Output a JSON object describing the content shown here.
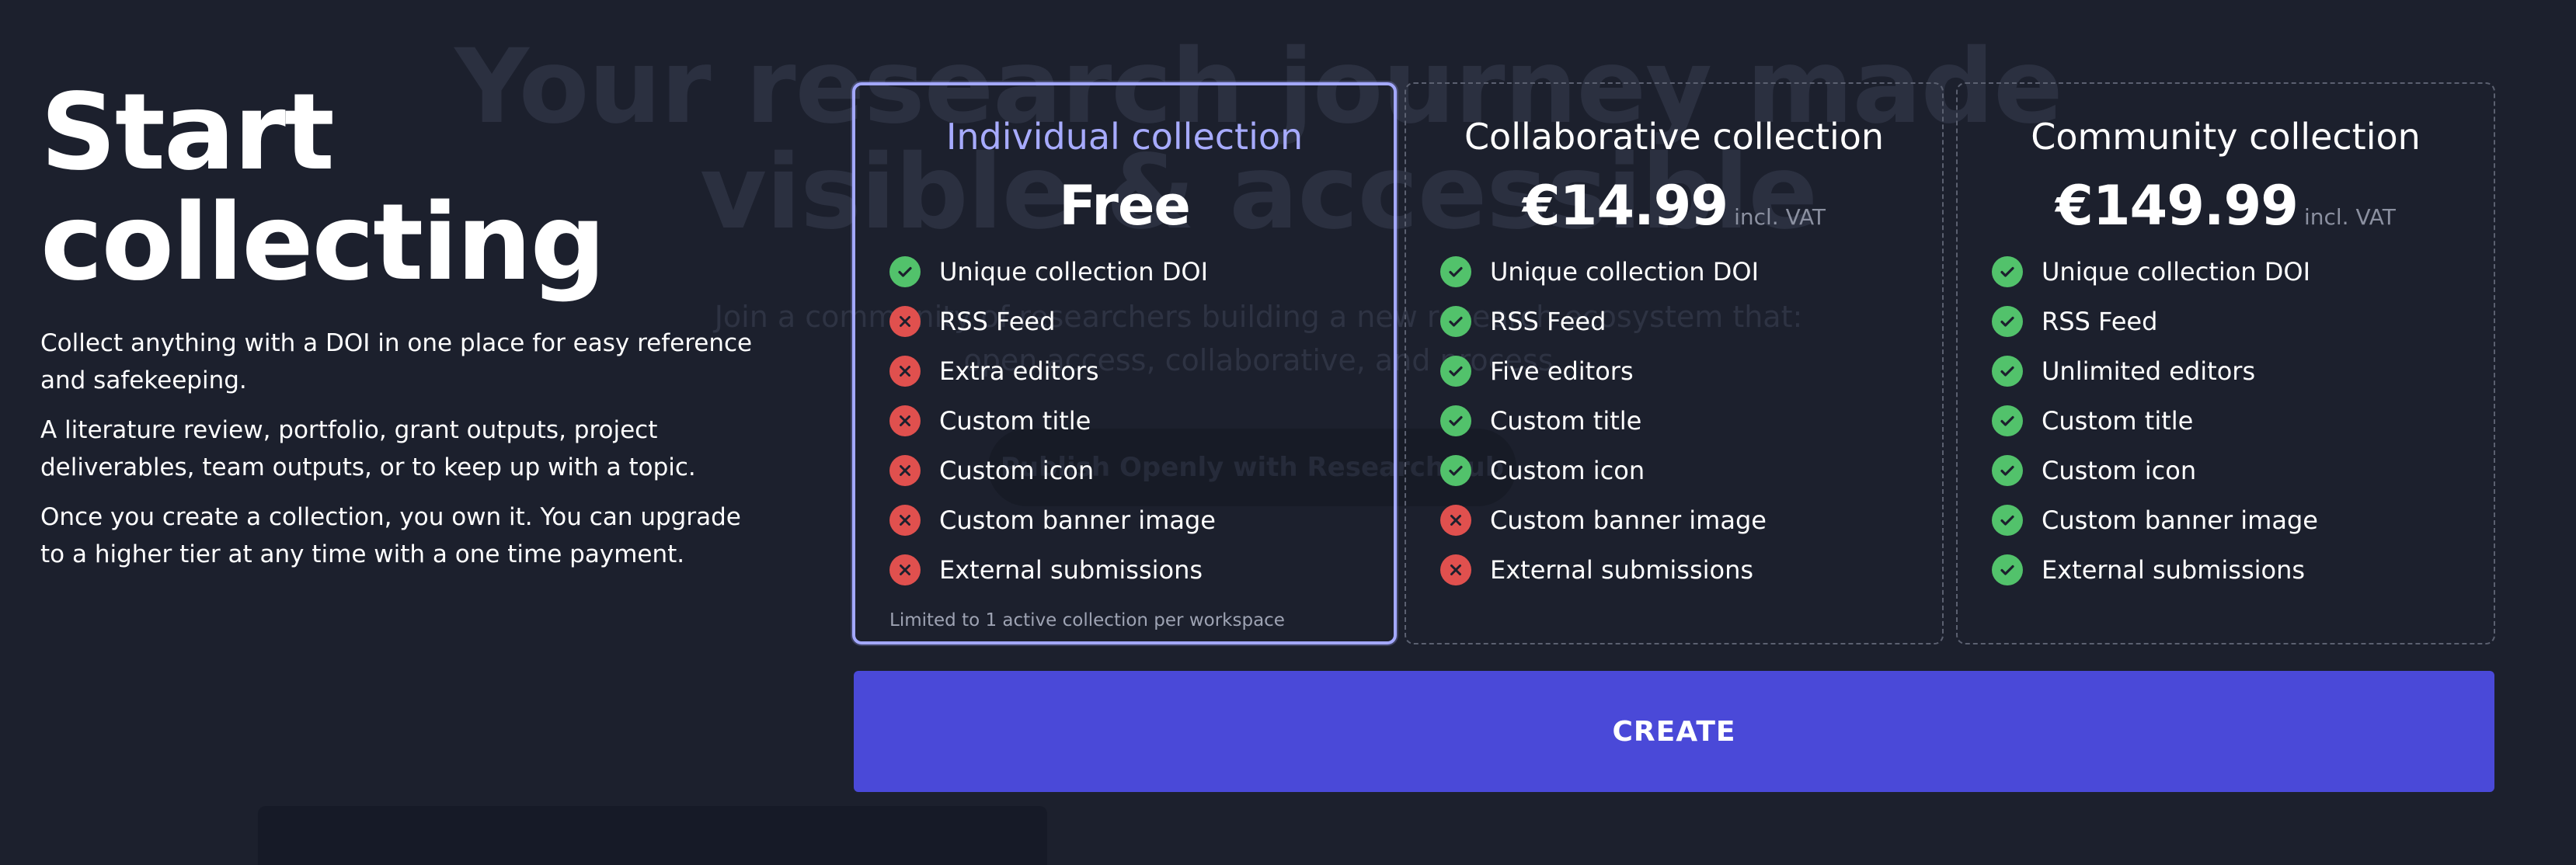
{
  "background": {
    "hero_title": "Your research journey made visible & accessible",
    "hero_subtitle": "Join a community of researchers building a new research ecosystem that: open access, collaborative, and process",
    "cta_label": "Publish Openly with ResearchHub"
  },
  "intro": {
    "title": "Start collecting",
    "paragraphs": [
      "Collect anything with a DOI in one place for easy reference and safekeeping.",
      "A literature review, portfolio, grant outputs, project deliverables, team outputs, or to keep up with a topic.",
      "Once you create a collection, you own it. You can upgrade to a higher tier at any time with a one time payment."
    ]
  },
  "plans": [
    {
      "title": "Individual collection",
      "price": "Free",
      "vat": "",
      "selected": true,
      "note": "Limited to 1 active collection per workspace",
      "features": [
        {
          "label": "Unique collection DOI",
          "included": true
        },
        {
          "label": "RSS Feed",
          "included": false
        },
        {
          "label": "Extra editors",
          "included": false
        },
        {
          "label": "Custom title",
          "included": false
        },
        {
          "label": "Custom icon",
          "included": false
        },
        {
          "label": "Custom banner image",
          "included": false
        },
        {
          "label": "External submissions",
          "included": false
        }
      ]
    },
    {
      "title": "Collaborative collection",
      "price": "€14.99",
      "vat": "incl. VAT",
      "selected": false,
      "features": [
        {
          "label": "Unique collection DOI",
          "included": true
        },
        {
          "label": "RSS Feed",
          "included": true
        },
        {
          "label": "Five editors",
          "included": true
        },
        {
          "label": "Custom title",
          "included": true
        },
        {
          "label": "Custom icon",
          "included": true
        },
        {
          "label": "Custom banner image",
          "included": false
        },
        {
          "label": "External submissions",
          "included": false
        }
      ]
    },
    {
      "title": "Community collection",
      "price": "€149.99",
      "vat": "incl. VAT",
      "selected": false,
      "features": [
        {
          "label": "Unique collection DOI",
          "included": true
        },
        {
          "label": "RSS Feed",
          "included": true
        },
        {
          "label": "Unlimited editors",
          "included": true
        },
        {
          "label": "Custom title",
          "included": true
        },
        {
          "label": "Custom icon",
          "included": true
        },
        {
          "label": "Custom banner image",
          "included": true
        },
        {
          "label": "External submissions",
          "included": true
        }
      ]
    }
  ],
  "create_button": {
    "label": "CREATE"
  },
  "colors": {
    "background": "#1c202d",
    "accent": "#4a49d8",
    "selected_border": "#a3a8ff",
    "check": "#52c26b",
    "cross": "#e0504e"
  }
}
